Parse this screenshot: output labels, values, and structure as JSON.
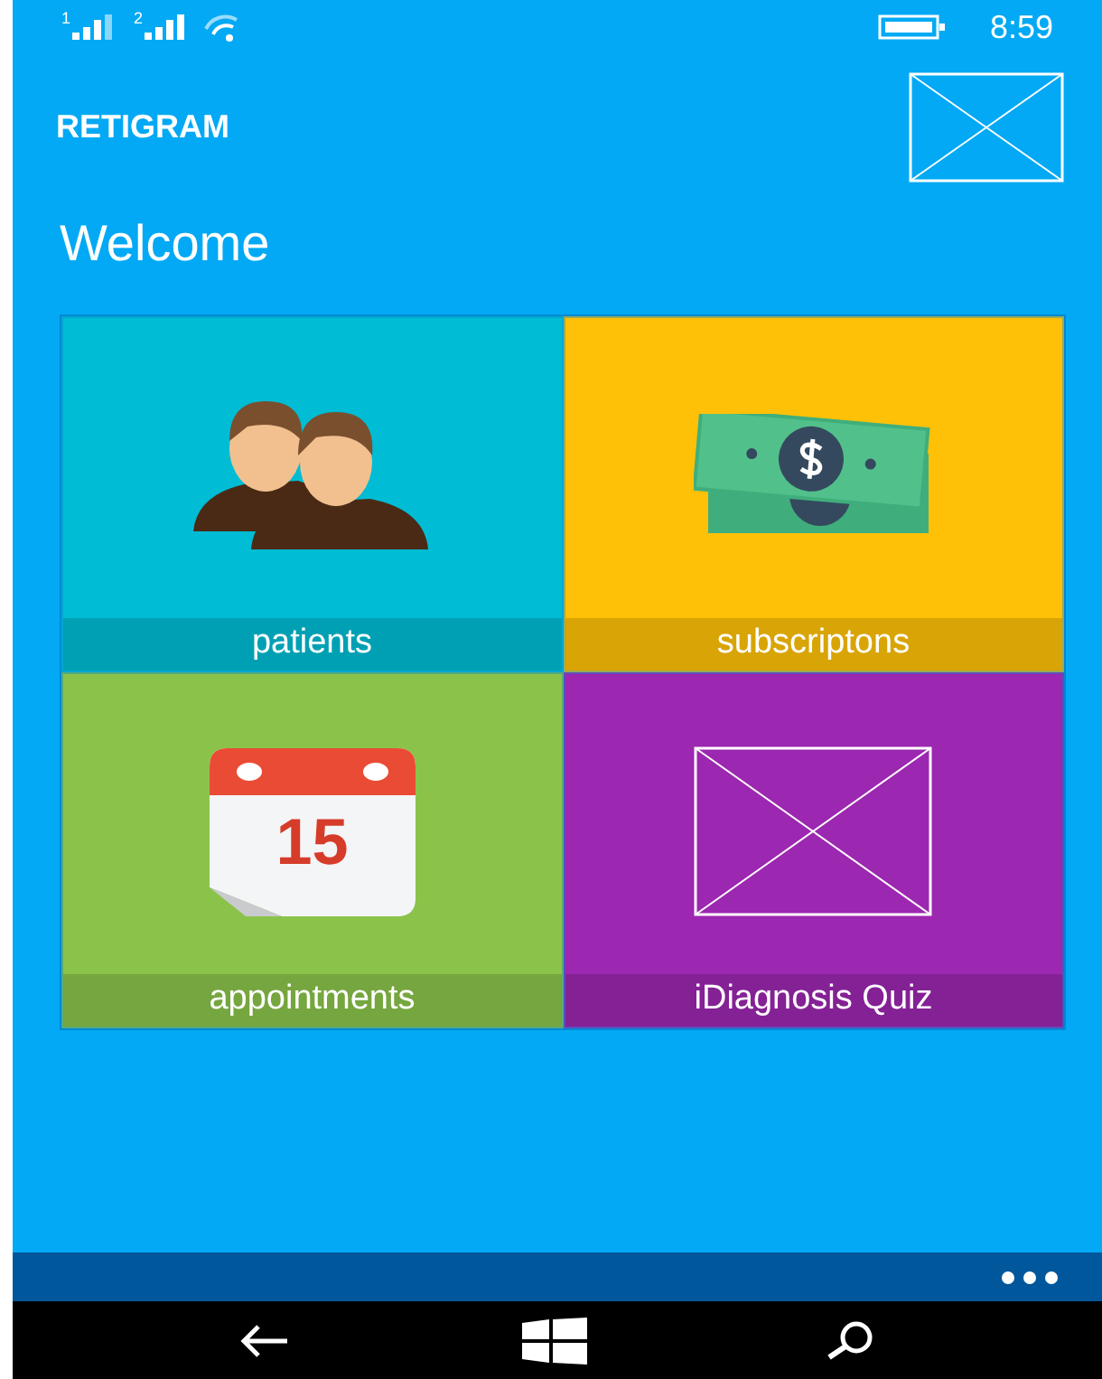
{
  "status_bar": {
    "sim_1": "1",
    "sim_2": "2",
    "time": "8:59"
  },
  "header": {
    "app_name": "RETIGRAM"
  },
  "welcome": "Welcome",
  "tiles": [
    {
      "kind": "people",
      "label": "patients",
      "color": "#00bcd4"
    },
    {
      "kind": "money",
      "label": "subscriptons",
      "color": "#ffc107"
    },
    {
      "kind": "calendar",
      "label": "appointments",
      "color": "#8bc34a",
      "date": "15"
    },
    {
      "kind": "placeholder",
      "label": "iDiagnosis Quiz",
      "color": "#9c27b0"
    }
  ]
}
